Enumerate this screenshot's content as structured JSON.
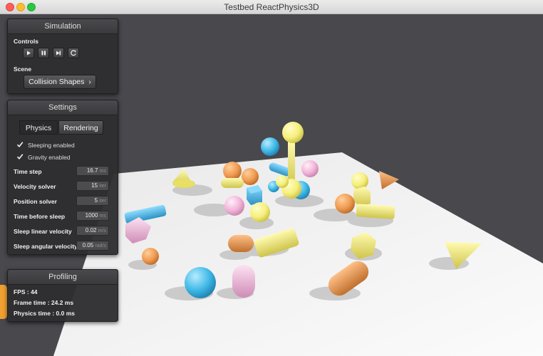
{
  "window": {
    "title": "Testbed ReactPhysics3D"
  },
  "simulation": {
    "title": "Simulation",
    "controls_label": "Controls",
    "controls": [
      "play-icon",
      "pause-icon",
      "step-icon",
      "restart-icon"
    ],
    "scene_label": "Scene",
    "scene_button": "Collision Shapes",
    "scene_chevron": "›"
  },
  "settings": {
    "title": "Settings",
    "tabs": [
      "Physics",
      "Rendering"
    ],
    "active_tab": "Physics",
    "checkboxes": [
      {
        "label": "Sleeping enabled",
        "checked": true
      },
      {
        "label": "Gravity enabled",
        "checked": true
      }
    ],
    "rows": [
      {
        "label": "Time step",
        "value": "16.7",
        "unit": "ms"
      },
      {
        "label": "Velocity solver",
        "value": "15",
        "unit": "iter"
      },
      {
        "label": "Position solver",
        "value": "5",
        "unit": "iter"
      },
      {
        "label": "Time before sleep",
        "value": "1000",
        "unit": "ms"
      },
      {
        "label": "Sleep linear velocity",
        "value": "0.02",
        "unit": "m/s"
      },
      {
        "label": "Sleep angular velocity",
        "value": "0.05",
        "unit": "rad/s"
      }
    ]
  },
  "profiling": {
    "title": "Profiling",
    "lines": [
      "FPS : 44",
      "Frame time : 24.2 ms",
      "Physics time : 0.0 ms"
    ]
  },
  "colors": {
    "background": "#48484d",
    "floor": "#f2f2f2",
    "yellow": "#f6ef7c",
    "orange": "#ef9a50",
    "cyan": "#3fb8e6",
    "pink": "#f2b3d7"
  }
}
